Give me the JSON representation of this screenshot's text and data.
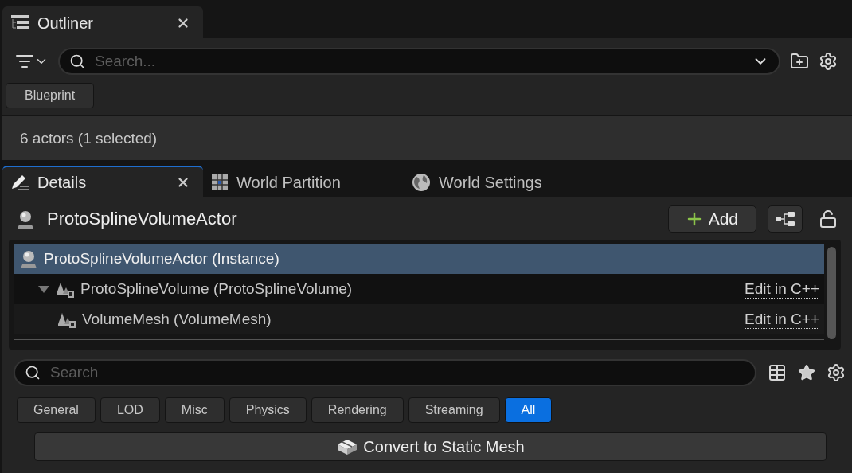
{
  "outliner_tab": {
    "title": "Outliner",
    "closable": true
  },
  "outliner": {
    "search": {
      "placeholder": "Search..."
    },
    "filter_chips": [
      {
        "label": "Blueprint"
      }
    ],
    "status": "6 actors (1 selected)"
  },
  "detail_tabs": [
    {
      "label": "Details",
      "selected": true,
      "closable": true,
      "kind": "details"
    },
    {
      "label": "World Partition",
      "selected": false,
      "closable": false,
      "kind": "partition"
    },
    {
      "label": "World Settings",
      "selected": false,
      "closable": false,
      "kind": "world"
    }
  ],
  "details": {
    "actor_name": "ProtoSplineVolumeActor",
    "add_button": "Add",
    "locked": false,
    "components": [
      {
        "label": "ProtoSplineVolumeActor (Instance)",
        "selected": true,
        "kind": "actor",
        "children": [
          {
            "label": "ProtoSplineVolume (ProtoSplineVolume)",
            "selected": false,
            "kind": "component",
            "expanded": true,
            "link": "Edit in C++",
            "children": [
              {
                "label": "VolumeMesh (VolumeMesh)",
                "selected": false,
                "kind": "component",
                "link": "Edit in C++"
              }
            ]
          }
        ]
      }
    ],
    "search": {
      "placeholder": "Search"
    },
    "categories": [
      {
        "label": "General",
        "selected": false
      },
      {
        "label": "LOD",
        "selected": false
      },
      {
        "label": "Misc",
        "selected": false
      },
      {
        "label": "Physics",
        "selected": false
      },
      {
        "label": "Rendering",
        "selected": false
      },
      {
        "label": "Streaming",
        "selected": false
      },
      {
        "label": "All",
        "selected": true
      }
    ],
    "convert_button": "Convert to Static Mesh"
  }
}
